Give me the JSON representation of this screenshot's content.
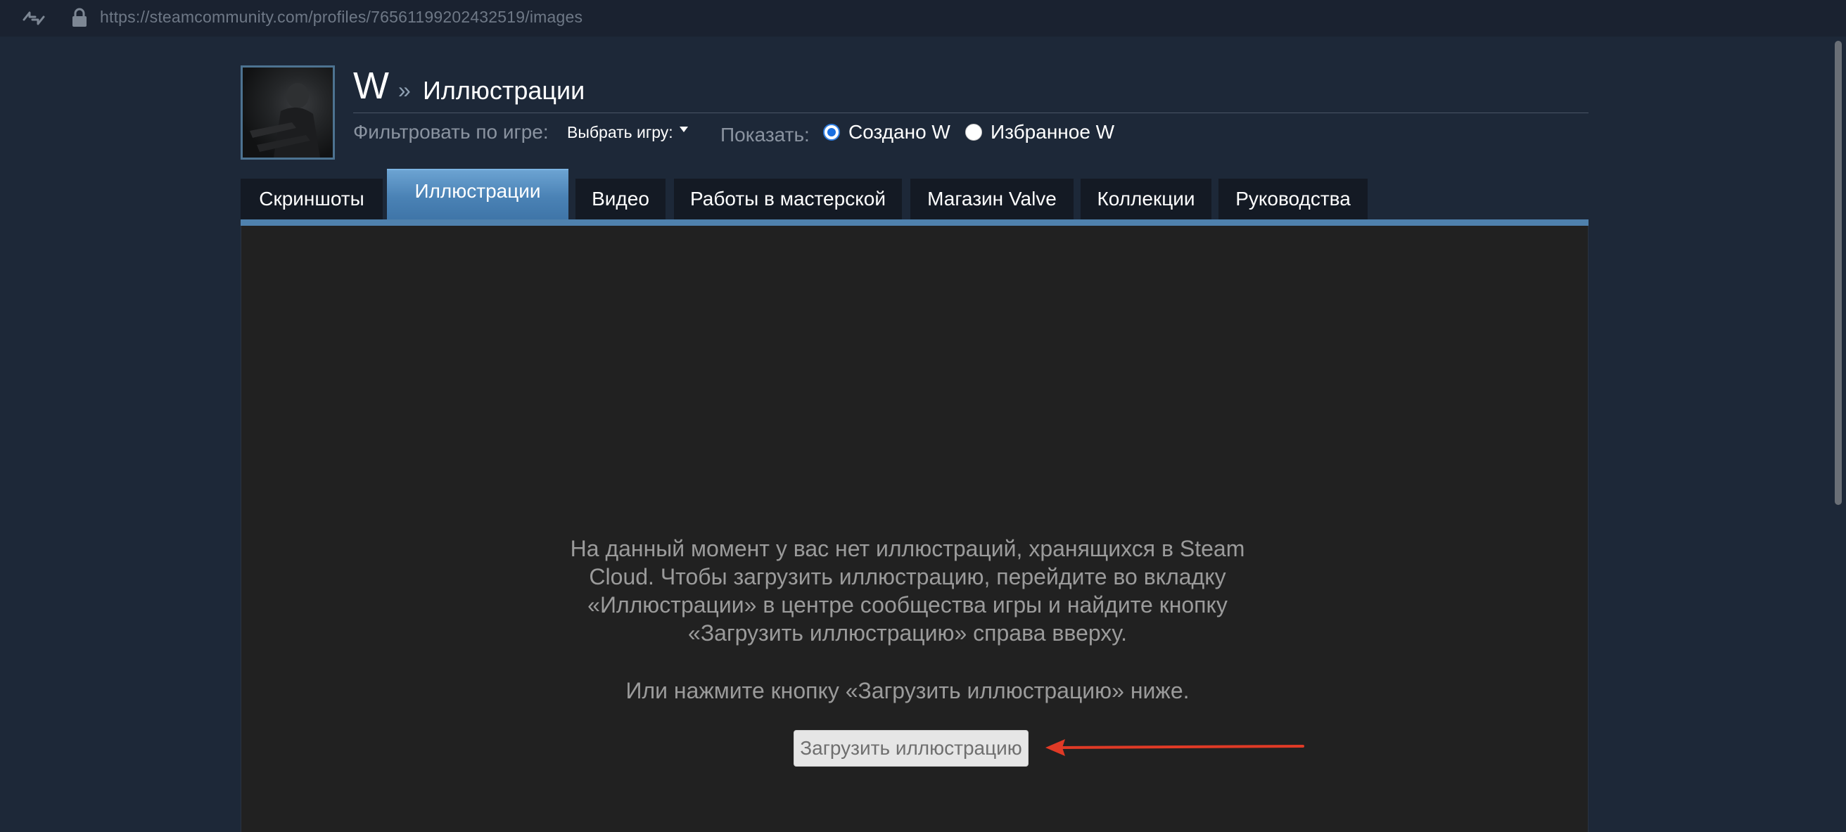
{
  "browser": {
    "url": "https://steamcommunity.com/profiles/76561199202432519/images"
  },
  "header": {
    "profile_name": "W",
    "separator": "»",
    "title": "Иллюстрации"
  },
  "filters": {
    "filter_label": "Фильтровать по игре:",
    "game_select_value": "Выбрать игру:",
    "show_label": "Показать:",
    "radio_created": "Создано W",
    "radio_favorite": "Избранное W"
  },
  "tabs": [
    {
      "label": "Скриншоты",
      "active": false
    },
    {
      "label": "Иллюстрации",
      "active": true
    },
    {
      "label": "Видео",
      "active": false
    },
    {
      "label": "Работы в мастерской",
      "active": false
    },
    {
      "label": "Магазин Valve",
      "active": false
    },
    {
      "label": "Коллекции",
      "active": false
    },
    {
      "label": "Руководства",
      "active": false
    }
  ],
  "content": {
    "empty_message": "На данный момент у вас нет иллюстраций, хранящихся в Steam\nCloud. Чтобы загрузить иллюстрацию, перейдите во вкладку\n«Иллюстрации» в центре сообщества игры и найдите кнопку\n«Загрузить иллюстрацию» справа вверху.",
    "empty_hint": "Или нажмите кнопку «Загрузить иллюстрацию» ниже.",
    "upload_button": "Загрузить иллюстрацию"
  },
  "colors": {
    "page_background": "#1d2838",
    "active_tab": "#4a82b5",
    "annotation_arrow": "#e03a26"
  }
}
